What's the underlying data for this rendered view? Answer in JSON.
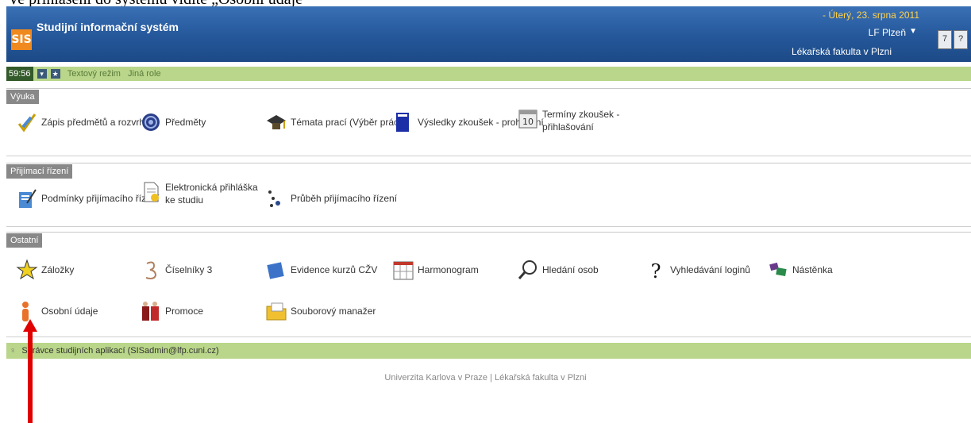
{
  "caption": "Ve přihlášení do systému vidíte „Osobní údaje“",
  "header": {
    "logo": "SIS",
    "title": "Studijní informační systém",
    "date": "- Úterý, 23. srpna 2011",
    "place": "LF Plzeň",
    "faculty": "Lékařská fakulta v Plzni"
  },
  "toolbar": {
    "timer": "59:56",
    "text_mode": "Textový režim",
    "other_role": "Jiná role"
  },
  "sections": {
    "vyuka": {
      "title": "Výuka",
      "items": [
        "Zápis předmětů a rozvrhu",
        "Předměty",
        "Témata prací (Výběr práce)",
        "Výsledky zkoušek - prohlížení",
        "Termíny zkoušek - přihlašování"
      ]
    },
    "prijimaci": {
      "title": "Přijímací řízení",
      "items": [
        "Podmínky přijímacího řízení",
        "Elektronická přihláška ke studiu",
        "Průběh přijímacího řízení"
      ]
    },
    "ostatni": {
      "title": "Ostatní",
      "items": [
        "Záložky",
        "Číselníky 3",
        "Evidence kurzů CŽV",
        "Harmonogram",
        "Hledání osob",
        "Vyhledávání loginů",
        "Nástěnka",
        "Osobní údaje",
        "Promoce",
        "Souborový manažer"
      ]
    }
  },
  "footer_bar": "Správce studijních aplikací (SISadmin@lfp.cuni.cz)",
  "footer": "Univerzita Karlova v Praze | Lékařská fakulta v Plzni",
  "colors": {
    "header_blue": "#24579a",
    "green_bar": "#b9d68a",
    "logo_orange": "#f08a1f",
    "date_yellow": "#ffd24a",
    "arrow_red": "#e00000"
  }
}
